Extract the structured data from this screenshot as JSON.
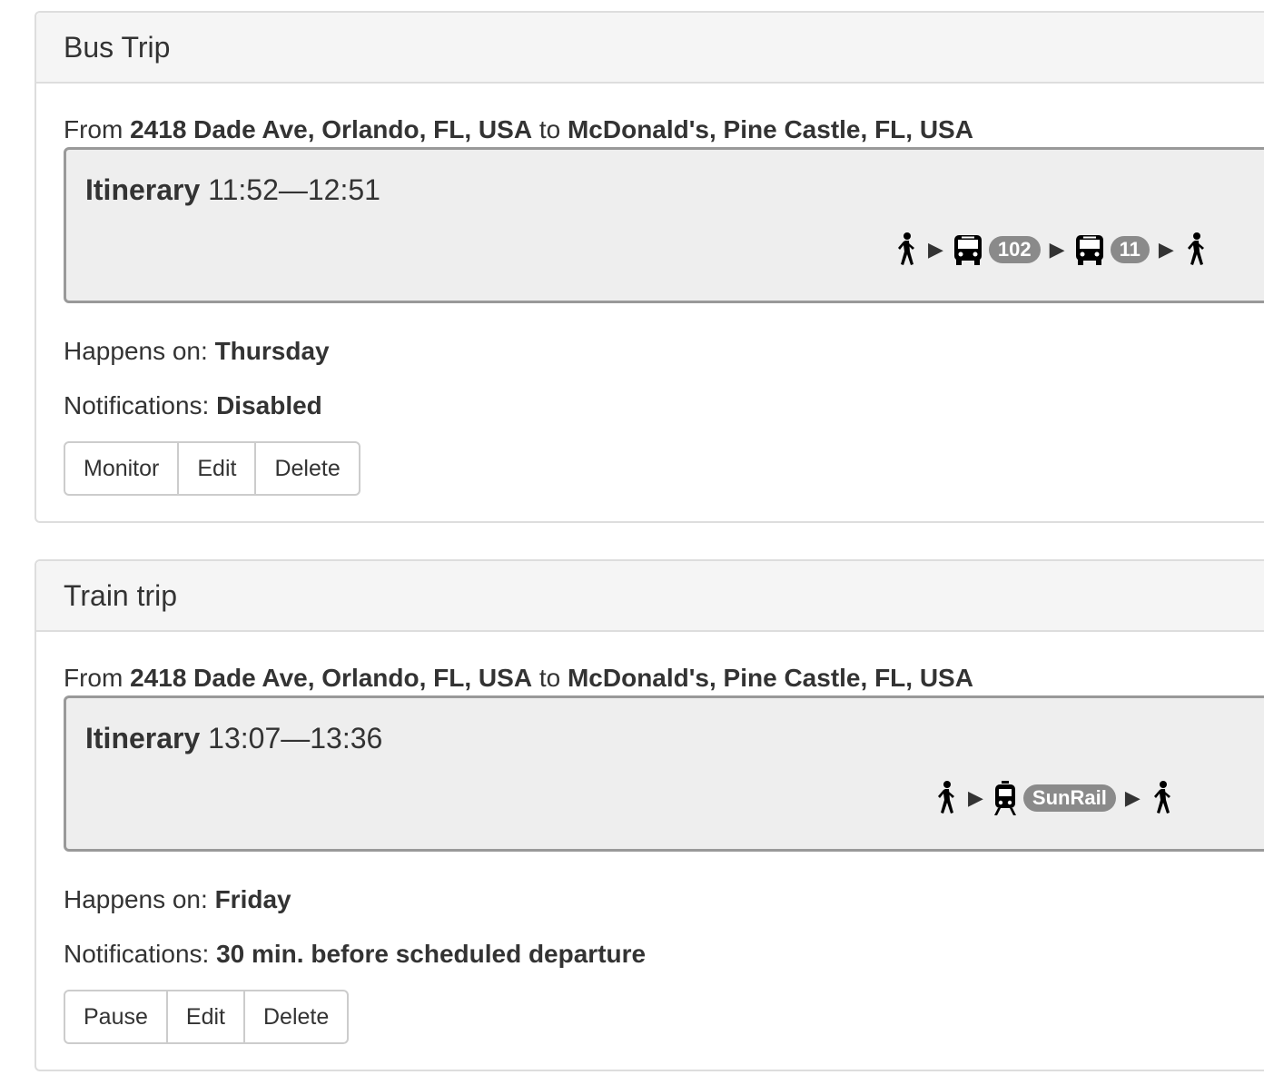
{
  "trips": [
    {
      "title": "Bus Trip",
      "from_prefix": "From",
      "from": "2418 Dade Ave, Orlando, FL, USA",
      "to_word": "to",
      "to": "McDonald's, Pine Castle, FL, USA",
      "itinerary_label": "Itinerary",
      "itinerary_time": "11:52—12:51",
      "legs": [
        {
          "mode": "walk",
          "icon": "walk-icon"
        },
        {
          "mode": "bus",
          "icon": "bus-icon",
          "route": "102"
        },
        {
          "mode": "bus",
          "icon": "bus-icon",
          "route": "11"
        },
        {
          "mode": "walk",
          "icon": "walk-icon"
        }
      ],
      "happens_label": "Happens on:",
      "happens_value": "Thursday",
      "notifications_label": "Notifications:",
      "notifications_value": "Disabled",
      "buttons": [
        "Monitor",
        "Edit",
        "Delete"
      ]
    },
    {
      "title": "Train trip",
      "from_prefix": "From",
      "from": "2418 Dade Ave, Orlando, FL, USA",
      "to_word": "to",
      "to": "McDonald's, Pine Castle, FL, USA",
      "itinerary_label": "Itinerary",
      "itinerary_time": "13:07—13:36",
      "legs": [
        {
          "mode": "walk",
          "icon": "walk-icon"
        },
        {
          "mode": "rail",
          "icon": "train-icon",
          "route": "SunRail"
        },
        {
          "mode": "walk",
          "icon": "walk-icon"
        }
      ],
      "happens_label": "Happens on:",
      "happens_value": "Friday",
      "notifications_label": "Notifications:",
      "notifications_value": "30 min. before scheduled departure",
      "buttons": [
        "Pause",
        "Edit",
        "Delete"
      ]
    }
  ],
  "arrow_glyph": "▶",
  "colors": {
    "heading_bg": "#f5f5f5",
    "itinerary_bg": "#eeeeee",
    "badge_bg": "#8a8a8a",
    "border": "#dddddd"
  }
}
